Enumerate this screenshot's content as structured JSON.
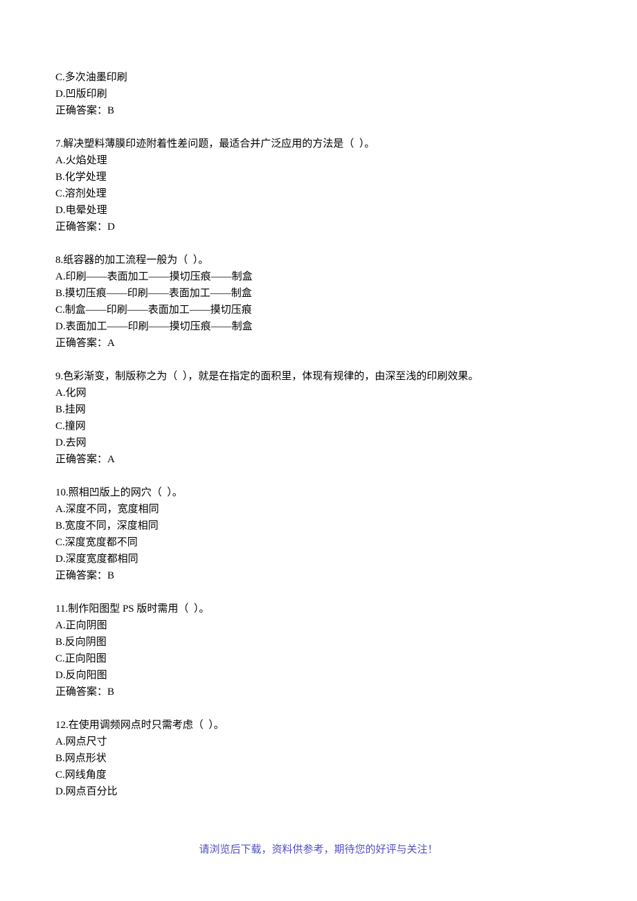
{
  "q6_tail": {
    "options": [
      "C.多次油墨印刷",
      "D.凹版印刷"
    ],
    "answer": "正确答案：B"
  },
  "questions": [
    {
      "stem": "7.解决塑料薄膜印迹附着性差问题，最适合并广泛应用的方法是（  ）。",
      "options": [
        "A.火焰处理",
        "B.化学处理",
        "C.溶剂处理",
        "D.电晕处理"
      ],
      "answer": "正确答案：D"
    },
    {
      "stem": "8.纸容器的加工流程一般为（  ）。",
      "options": [
        "A.印刷——表面加工——摸切压痕——制盒",
        "B.摸切压痕——印刷——表面加工——制盒",
        "C.制盒——印刷——表面加工——摸切压痕",
        "D.表面加工——印刷——摸切压痕——制盒"
      ],
      "answer": "正确答案：A"
    },
    {
      "stem": "9.色彩渐变，制版称之为（  ），就是在指定的面积里，体现有规律的，由深至浅的印刷效果。",
      "options": [
        "A.化网",
        "B.挂网",
        "C.撞网",
        "D.去网"
      ],
      "answer": "正确答案：A"
    },
    {
      "stem": "10.照相凹版上的网穴（  ）。",
      "options": [
        "A.深度不同，宽度相同",
        "B.宽度不同，深度相同",
        "C.深度宽度都不同",
        "D.深度宽度都相同"
      ],
      "answer": "正确答案：B"
    },
    {
      "stem": "11.制作阳图型 PS 版时需用（  ）。",
      "options": [
        "A.正向阴图",
        "B.反向阴图",
        "C.正向阳图",
        "D.反向阳图"
      ],
      "answer": "正确答案：B"
    },
    {
      "stem": "12.在使用调频网点时只需考虑（  ）。",
      "options": [
        "A.网点尺寸",
        "B.网点形状",
        "C.网线角度",
        "D.网点百分比"
      ],
      "answer": ""
    }
  ],
  "footer": "请浏览后下载，资料供参考，期待您的好评与关注！"
}
